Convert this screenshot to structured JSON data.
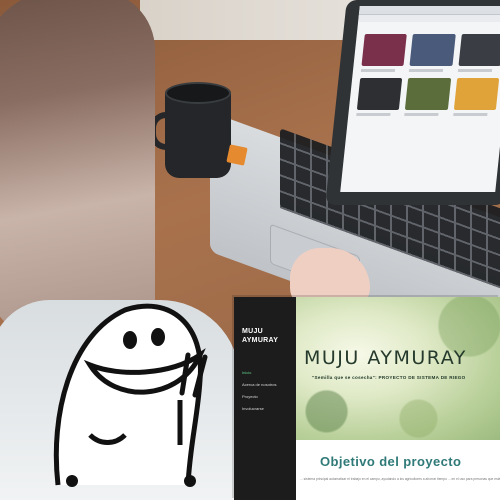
{
  "site": {
    "brand": "MUJU\nAYMURAY",
    "nav": [
      {
        "label": "Inicio",
        "active": true
      },
      {
        "label": "Acerca de nosotros",
        "active": false
      },
      {
        "label": "Proyecto",
        "active": false
      },
      {
        "label": "Involucrarse",
        "active": false
      }
    ],
    "hero": {
      "title": "MUJU AYMURAY",
      "subtitle": "\"Semilla que  se cosecha\": PROYECTO DE SISTEMA DE RIEGO"
    },
    "objective": {
      "title": "Objetivo del proyecto",
      "text": "... sistema principal automatizar el trabajo en el campo, ayudando a los agricultores a ahorrar tiempo ... en el uso para personas que están quintando plantas en sus hogares para que, por diversas razones, ..."
    }
  },
  "colors": {
    "sidebar_bg": "#1c1c1c",
    "nav_active": "#5fd189",
    "objective_title": "#2f7a78",
    "hero_title": "#253a2c"
  },
  "icons": [
    "flork-sticker-peace-sign"
  ]
}
